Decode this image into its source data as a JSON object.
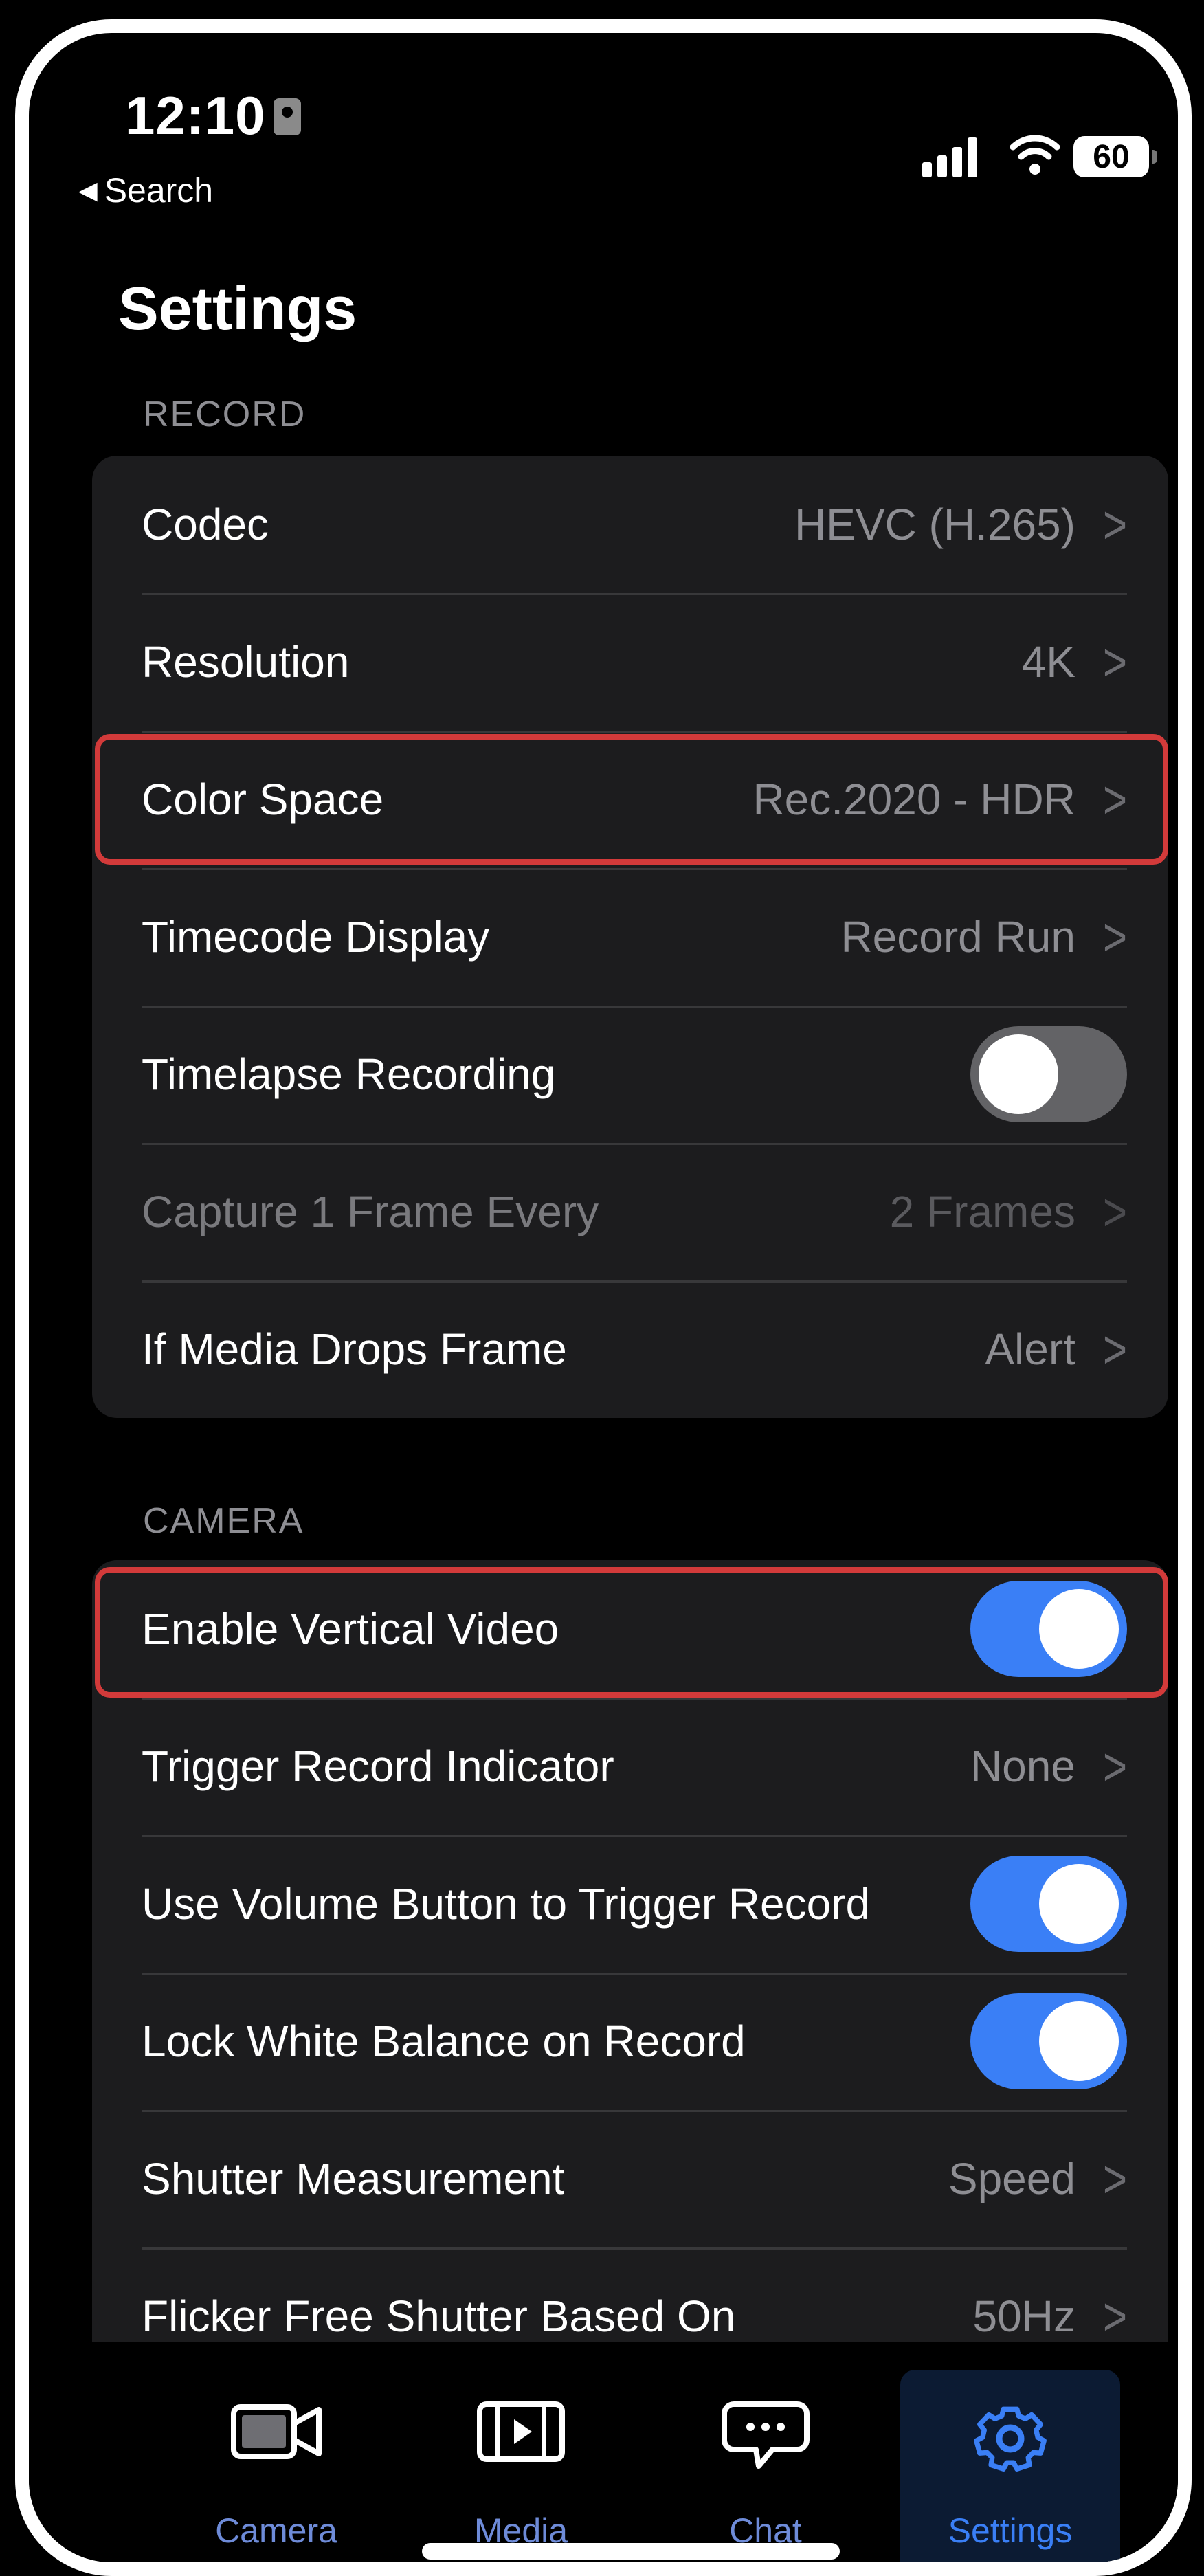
{
  "status_bar": {
    "time": "12:10",
    "back_label": "Search",
    "battery": "60"
  },
  "page_title": "Settings",
  "record_section": {
    "header": "RECORD",
    "rows": [
      {
        "label": "Codec",
        "value": "HEVC (H.265)"
      },
      {
        "label": "Resolution",
        "value": "4K"
      },
      {
        "label": "Color Space",
        "value": "Rec.2020 - HDR"
      },
      {
        "label": "Timecode Display",
        "value": "Record Run"
      },
      {
        "label": "Timelapse Recording",
        "toggle": false
      },
      {
        "label": "Capture 1 Frame Every",
        "value": "2 Frames",
        "disabled": true
      },
      {
        "label": "If Media Drops Frame",
        "value": "Alert"
      }
    ]
  },
  "camera_section": {
    "header": "CAMERA",
    "rows": [
      {
        "label": "Enable Vertical Video",
        "toggle": true
      },
      {
        "label": "Trigger Record Indicator",
        "value": "None"
      },
      {
        "label": "Use Volume Button to Trigger Record",
        "toggle": true
      },
      {
        "label": "Lock White Balance on Record",
        "toggle": true
      },
      {
        "label": "Shutter Measurement",
        "value": "Speed"
      },
      {
        "label": "Flicker Free Shutter Based On",
        "value": "50Hz"
      }
    ]
  },
  "tabbar": {
    "tabs": [
      {
        "label": "Camera",
        "icon": "camera-icon"
      },
      {
        "label": "Media",
        "icon": "film-icon"
      },
      {
        "label": "Chat",
        "icon": "chat-bubble-icon"
      },
      {
        "label": "Settings",
        "icon": "gear-icon",
        "active": true
      }
    ]
  },
  "colors": {
    "accent": "#3a7ff6",
    "highlight_border": "#d23a3a",
    "group_bg": "#1c1c1e"
  }
}
